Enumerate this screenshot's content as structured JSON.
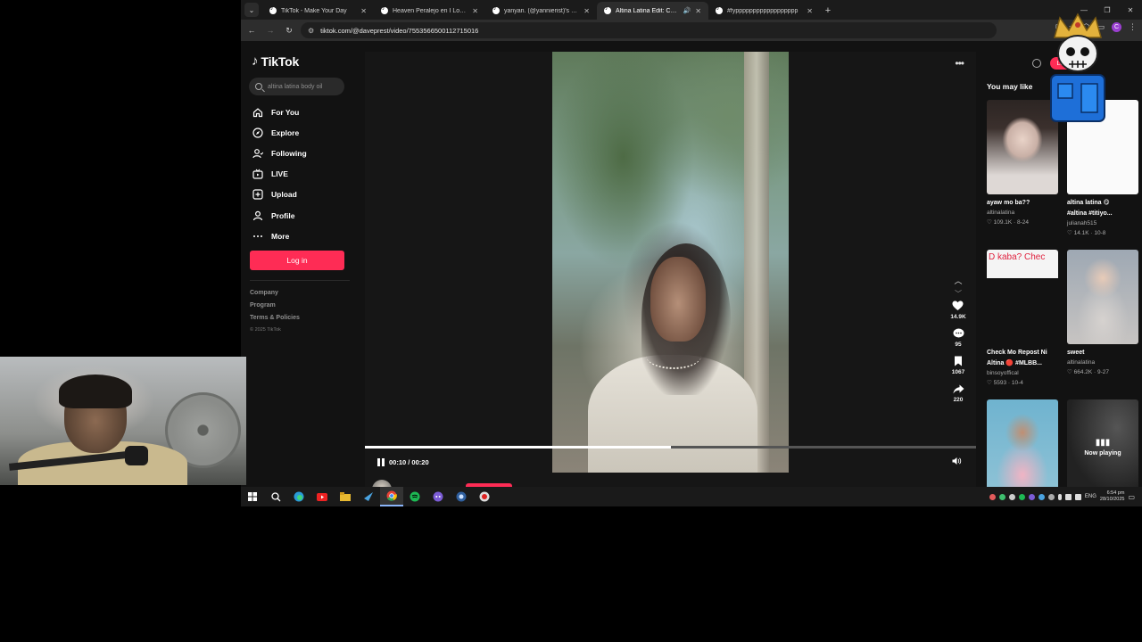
{
  "browser": {
    "tabs": [
      {
        "title": "TikTok - Make Your Day",
        "active": false
      },
      {
        "title": "Heaven Peralejo en I Love You",
        "active": false
      },
      {
        "title": "yanyan. (@yannierist)'s videos",
        "active": false
      },
      {
        "title": "Altina Latina Edit: Creative",
        "active": true
      },
      {
        "title": "#fypppppppppppppppppp",
        "active": false
      }
    ],
    "url": "tiktok.com/@daveprest/video/7553566500112715016",
    "profile_initial": "C"
  },
  "sidebar": {
    "logo": "TikTok",
    "search_query": "altina latina body oil",
    "nav": [
      {
        "label": "For You",
        "icon": "home-icon"
      },
      {
        "label": "Explore",
        "icon": "compass-icon"
      },
      {
        "label": "Following",
        "icon": "following-icon"
      },
      {
        "label": "LIVE",
        "icon": "live-icon"
      },
      {
        "label": "Upload",
        "icon": "upload-icon"
      },
      {
        "label": "Profile",
        "icon": "profile-icon"
      },
      {
        "label": "More",
        "icon": "more-icon"
      }
    ],
    "login_label": "Log in",
    "footer_links": [
      "Company",
      "Program",
      "Terms & Policies"
    ],
    "copyright": "© 2025 TikTok"
  },
  "player": {
    "time": "00:10 / 00:20",
    "progress": 0.5,
    "author": "daveprest",
    "likes": "14.9K",
    "comments": "95",
    "saves": "1067",
    "shares": "220"
  },
  "right": {
    "login_label": "Log in",
    "heading": "You may like",
    "recs": [
      {
        "title": "ayaw mo ba??",
        "title2": "",
        "author": "altinalatina",
        "stats": "♡ 109.1K · 8-24"
      },
      {
        "title": "altina latina 😋",
        "title2": "#altina #titiyo...",
        "author": "julianah515",
        "stats": "♡ 14.1K · 10-8"
      },
      {
        "title": "Check Mo Repost Ni",
        "title2": "Altina 🔴 #MLBB...",
        "author": "binsoyoffical",
        "stats": "♡ 5593 · 10-4",
        "caption": "D kaba? Chec"
      },
      {
        "title": "sweet",
        "title2": "",
        "author": "altinalatina",
        "stats": "♡ 664.2K · 9-27"
      }
    ],
    "now_playing": "Now playing"
  },
  "taskbar": {
    "lang": "ENG",
    "time": "6:54 pm",
    "date": "28/10/2025"
  },
  "colors": {
    "brand": "#fe2c55",
    "background": "#121212"
  }
}
